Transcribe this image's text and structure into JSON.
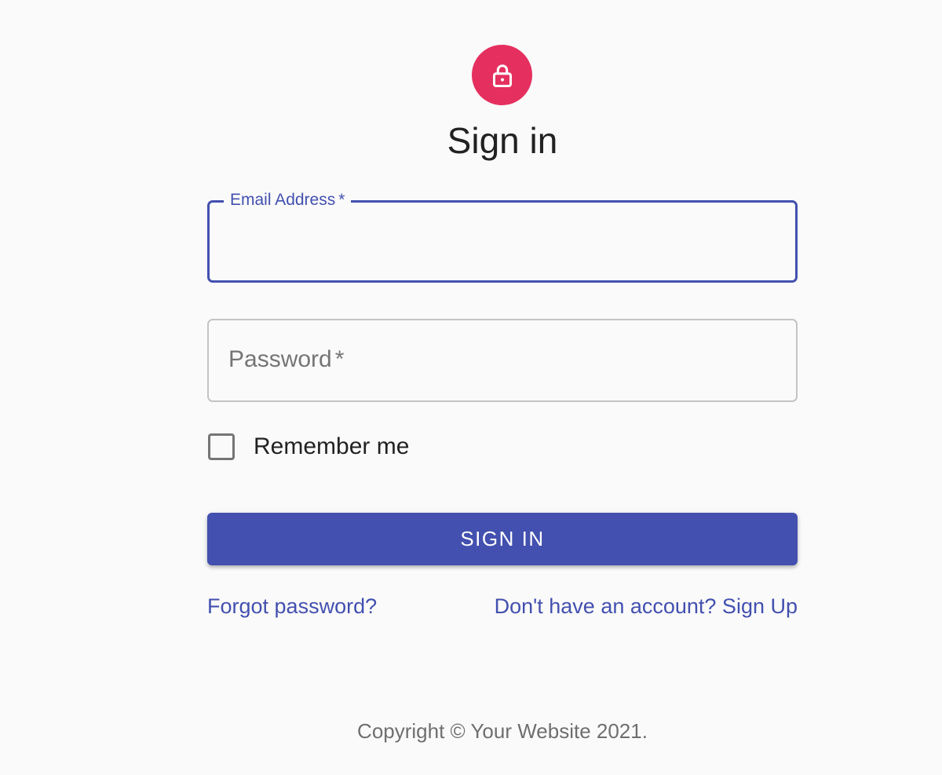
{
  "colors": {
    "primary": "#4350af",
    "secondary": "#e5305f",
    "background": "#fafafa",
    "muted_text": "#757575"
  },
  "header": {
    "icon": "lock-icon",
    "title": "Sign in"
  },
  "form": {
    "email": {
      "label": "Email Address",
      "required_marker": "*",
      "value": ""
    },
    "password": {
      "label": "Password",
      "required_marker": "*",
      "value": ""
    },
    "remember_me": {
      "label": "Remember me",
      "checked": false
    },
    "submit_label": "SIGN IN"
  },
  "links": {
    "forgot_password": "Forgot password?",
    "sign_up": "Don't have an account? Sign Up"
  },
  "footer": {
    "copyright": "Copyright © Your Website 2021."
  }
}
